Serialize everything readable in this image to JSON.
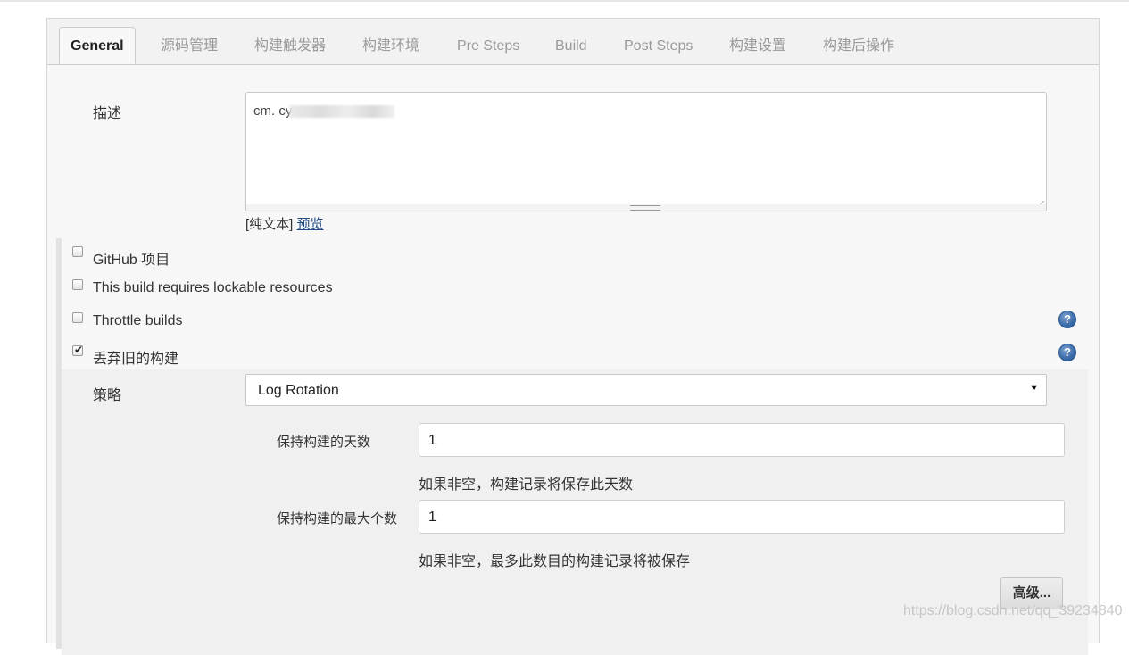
{
  "tabs": [
    {
      "label": "General",
      "active": true
    },
    {
      "label": "源码管理"
    },
    {
      "label": "构建触发器"
    },
    {
      "label": "构建环境"
    },
    {
      "label": "Pre Steps"
    },
    {
      "label": "Build"
    },
    {
      "label": "Post Steps"
    },
    {
      "label": "构建设置"
    },
    {
      "label": "构建后操作"
    }
  ],
  "description": {
    "label": "描述",
    "value": "cm. cy",
    "format_prefix": "[纯文本]",
    "preview_link": "预览"
  },
  "options": [
    {
      "label": "GitHub 项目",
      "checked": false,
      "help": false
    },
    {
      "label": "This build requires lockable resources",
      "checked": false,
      "help": false
    },
    {
      "label": "Throttle builds",
      "checked": false,
      "help": true
    },
    {
      "label": "丢弃旧的构建",
      "checked": true,
      "help": true
    }
  ],
  "strategy": {
    "label": "策略",
    "selected": "Log Rotation",
    "days_label": "保持构建的天数",
    "days_value": "1",
    "days_hint": "如果非空，构建记录将保存此天数",
    "max_label": "保持构建的最大个数",
    "max_value": "1",
    "max_hint": "如果非空，最多此数目的构建记录将被保存",
    "advanced_button": "高级..."
  },
  "icons": {
    "help": "help-icon",
    "dropdown": "dropdown-arrow-icon",
    "check": "check-icon"
  },
  "colors": {
    "link": "#204a87",
    "help_icon": "#3a6aa8",
    "panel_bg": "#f7f7f7"
  },
  "watermark": "https://blog.csdn.net/qq_39234840"
}
